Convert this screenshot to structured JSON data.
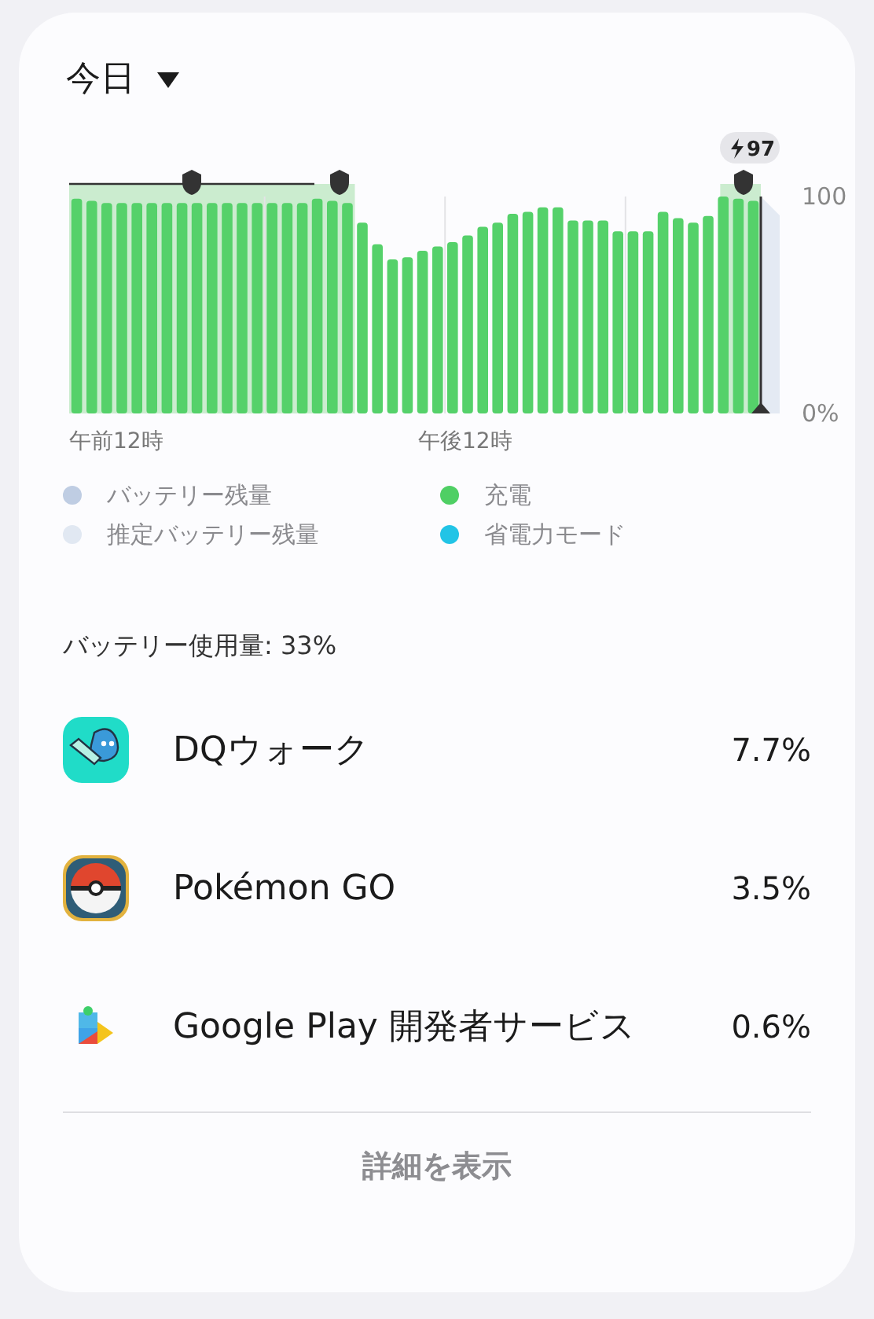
{
  "period": {
    "label": "今日"
  },
  "chart_data": {
    "type": "bar",
    "series": [
      {
        "color": "#55d16a",
        "values": [
          99,
          98,
          97,
          97,
          97,
          97,
          97,
          97,
          97,
          97,
          97,
          97,
          97,
          97,
          97,
          97,
          99,
          98,
          97,
          88,
          78,
          71,
          72,
          75,
          77,
          79,
          82,
          86,
          88,
          92,
          93,
          95,
          95,
          89,
          89,
          89,
          84,
          84,
          84,
          93,
          90,
          88,
          91,
          100,
          99,
          98
        ]
      }
    ],
    "yticks": [
      {
        "value": 0,
        "label": "0%"
      },
      {
        "value": 100,
        "label": "100"
      }
    ],
    "ylim": [
      0,
      100
    ]
  },
  "charge_badge": "97",
  "time_labels": [
    "午前12時",
    "午後12時"
  ],
  "legend": [
    {
      "label": "バッテリー残量",
      "color": "#bfcde3"
    },
    {
      "label": "充電",
      "color": "#4fcf64"
    },
    {
      "label": "推定バッテリー残量",
      "color": "#e1e8f2"
    },
    {
      "label": "省電力モード",
      "color": "#22c4e6"
    }
  ],
  "usage_title": "バッテリー使用量: 33%",
  "apps": [
    {
      "kind": "dq",
      "name": "DQウォーク",
      "percent": "7.7%"
    },
    {
      "kind": "pokemon",
      "name": "Pokémon GO",
      "percent": "3.5%"
    },
    {
      "kind": "play",
      "name": "Google Play 開発者サービス",
      "percent": "0.6%"
    }
  ],
  "details_button": "詳細を表示"
}
